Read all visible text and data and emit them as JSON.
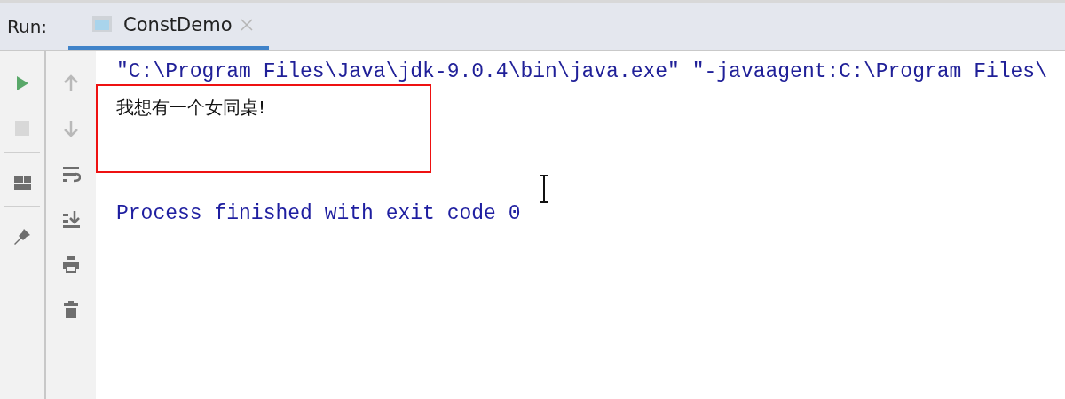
{
  "run_panel": {
    "label": "Run:",
    "tabs": [
      {
        "label": "ConstDemo",
        "selected": true
      }
    ],
    "toolbar_primary": [
      {
        "kind": "run",
        "disabled": false
      },
      {
        "kind": "stop",
        "disabled": true
      },
      {
        "kind": "separator"
      },
      {
        "kind": "layout",
        "disabled": false
      },
      {
        "kind": "separator"
      },
      {
        "kind": "pin",
        "disabled": false
      }
    ],
    "toolbar_secondary": [
      {
        "kind": "up",
        "disabled": true
      },
      {
        "kind": "down",
        "disabled": true
      },
      {
        "kind": "wrap",
        "disabled": false
      },
      {
        "kind": "scroll-end",
        "disabled": false
      },
      {
        "kind": "print",
        "disabled": false
      },
      {
        "kind": "trash",
        "disabled": false
      }
    ],
    "console": [
      {
        "kind": "command",
        "text": "\"C:\\Program Files\\Java\\jdk-9.0.4\\bin\\java.exe\" \"-javaagent:C:\\Program Files\\"
      },
      {
        "kind": "output",
        "text": "我想有一个女同桌!",
        "highlighted": true
      },
      {
        "kind": "blank"
      },
      {
        "kind": "blank"
      },
      {
        "kind": "exit",
        "text": "Process finished with exit code 0"
      }
    ]
  }
}
